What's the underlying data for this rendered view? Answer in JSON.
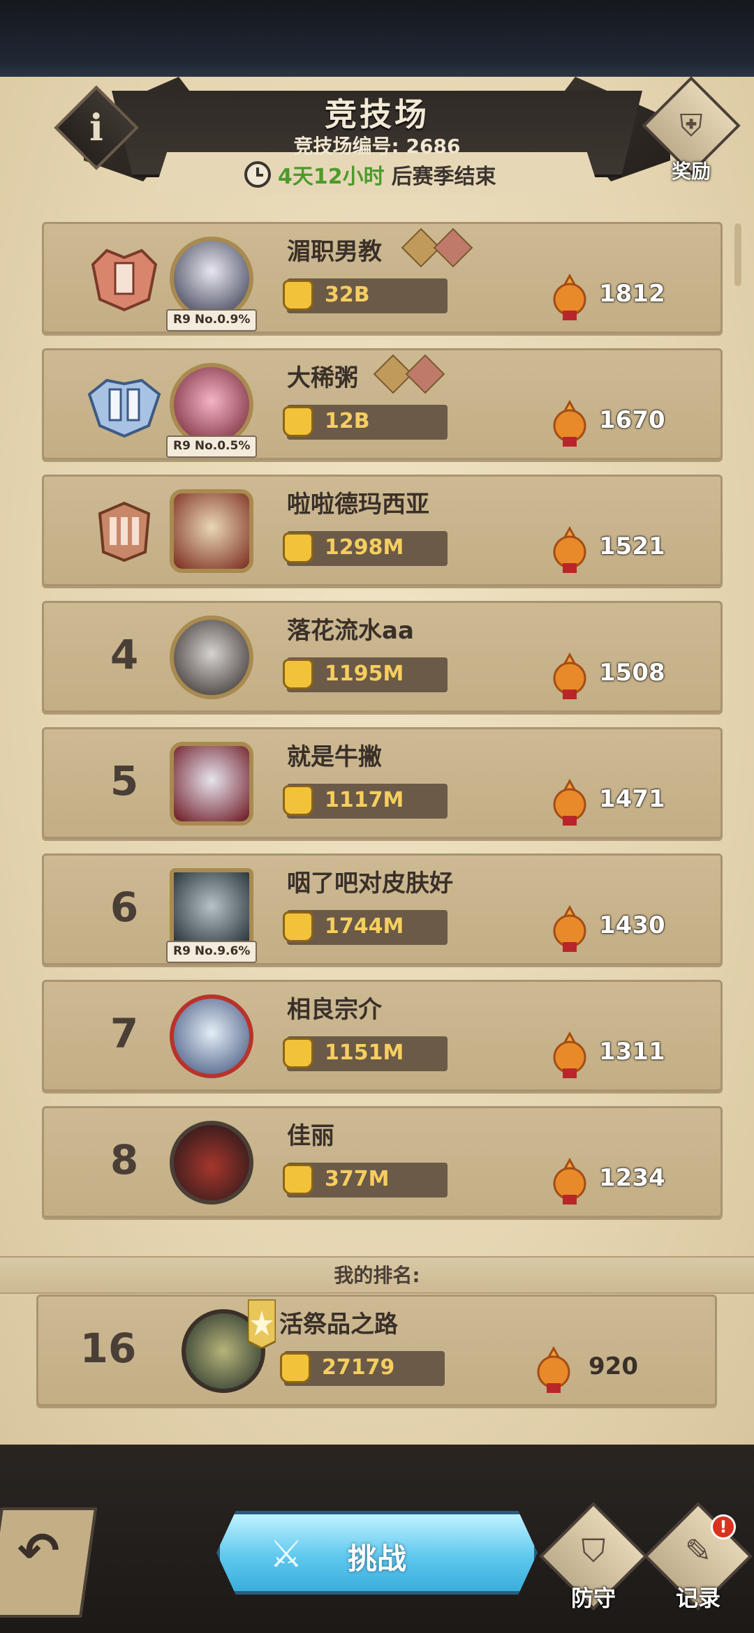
{
  "header": {
    "title": "竞技场",
    "arena_id": "竞技场编号: 2686",
    "season_time": "4天12小时",
    "season_suffix": "后赛季结束",
    "reward_label": "奖励"
  },
  "players": [
    {
      "rank": "1",
      "name": "湄职男教",
      "power": "32B",
      "score": "1812",
      "badge": "R9 No.0.9%"
    },
    {
      "rank": "2",
      "name": "大稀粥",
      "power": "12B",
      "score": "1670",
      "badge": "R9 No.0.5%"
    },
    {
      "rank": "3",
      "name": "啦啦德玛西亚",
      "power": "1298M",
      "score": "1521",
      "badge": ""
    },
    {
      "rank": "4",
      "name": "落花流水aa",
      "power": "1195M",
      "score": "1508",
      "badge": ""
    },
    {
      "rank": "5",
      "name": "就是牛撇",
      "power": "1117M",
      "score": "1471",
      "badge": ""
    },
    {
      "rank": "6",
      "name": "咽了吧对皮肤好",
      "power": "1744M",
      "score": "1430",
      "badge": "R9 No.9.6%"
    },
    {
      "rank": "7",
      "name": "相良宗介",
      "power": "1151M",
      "score": "1311",
      "badge": ""
    },
    {
      "rank": "8",
      "name": "佳丽",
      "power": "377M",
      "score": "1234",
      "badge": ""
    }
  ],
  "my_rank": {
    "label": "我的排名:",
    "rank": "16",
    "name": "活祭品之路",
    "power": "27179",
    "score": "920"
  },
  "bottom": {
    "challenge_label": "挑战",
    "defense_label": "防守",
    "record_label": "记录",
    "alert": "!"
  },
  "colors": {
    "parchment": "#e5d5b1",
    "row_bg": "#c7b38b",
    "power_text": "#f6ce60",
    "season_green": "#4d9a2b",
    "challenge_blue": "#5fc8ee"
  }
}
